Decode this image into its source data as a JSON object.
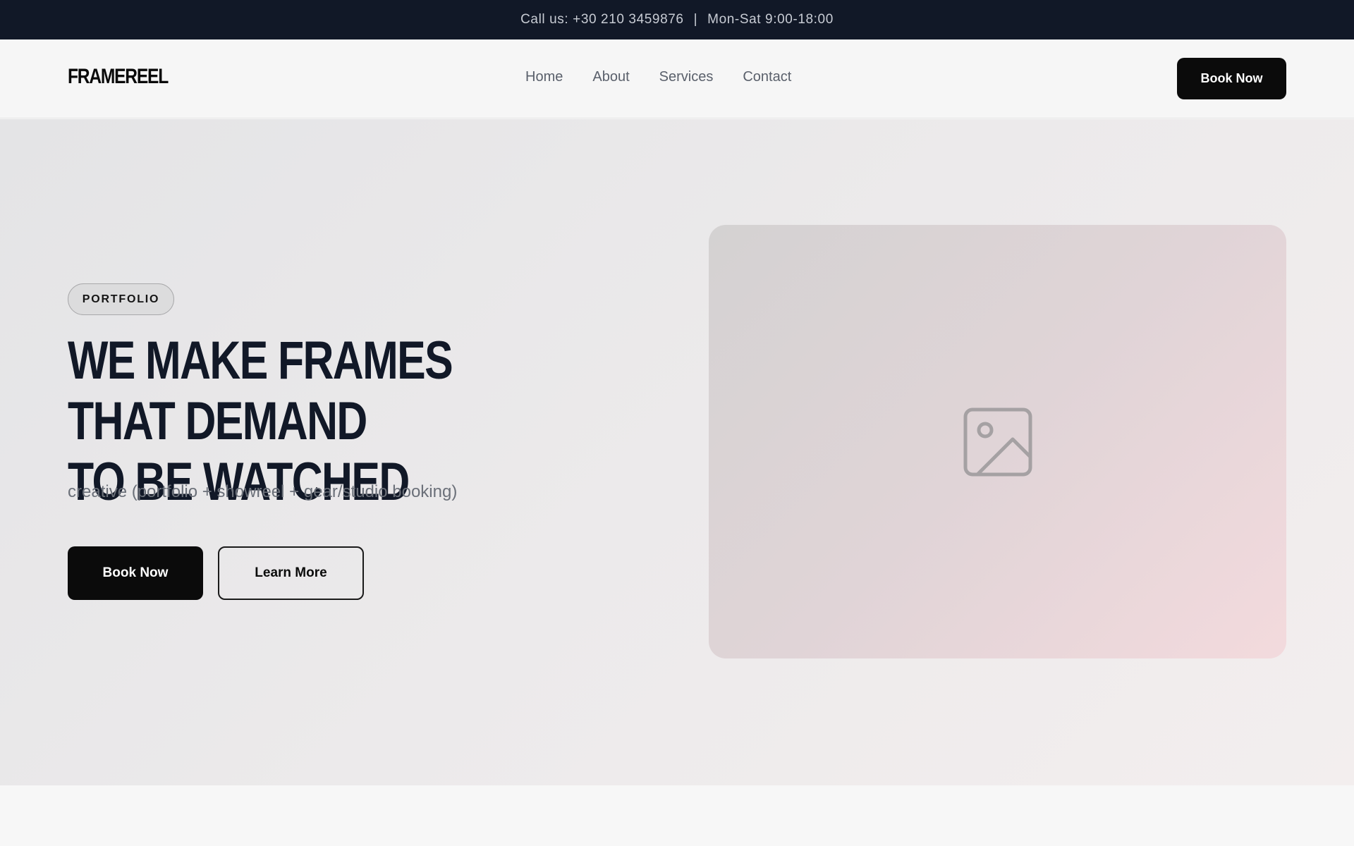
{
  "topbar": {
    "phone": "Call us: +30 210 3459876",
    "separator": "|",
    "hours": "Mon-Sat 9:00-18:00"
  },
  "header": {
    "logo": "FRAMEREEL",
    "nav": [
      "Home",
      "About",
      "Services",
      "Contact"
    ],
    "cta_label": "Book Now"
  },
  "hero": {
    "badge": "PORTFOLIO",
    "headline_line1": "WE MAKE FRAMES THAT DEMAND",
    "headline_line2": "TO BE WATCHED",
    "subtitle": "creative (portfolio + showreel + gear/studio booking)",
    "primary_label": "Book Now",
    "secondary_label": "Learn More",
    "media_icon": "image-placeholder-icon"
  },
  "colors": {
    "topbar_bg": "#111827",
    "button_bg": "#0b0b0b",
    "headline": "#111827"
  }
}
